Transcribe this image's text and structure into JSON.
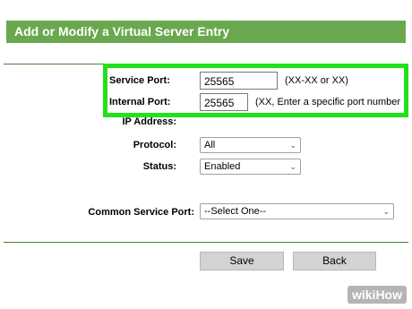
{
  "title": "Add or Modify a Virtual Server Entry",
  "fields": {
    "service_port": {
      "label": "Service Port:",
      "value": "25565",
      "hint": "(XX-XX or XX)"
    },
    "internal_port": {
      "label": "Internal Port:",
      "value": "25565",
      "hint": "(XX, Enter a specific port number"
    },
    "ip_address": {
      "label": "IP Address:"
    },
    "protocol": {
      "label": "Protocol:",
      "value": "All"
    },
    "status": {
      "label": "Status:",
      "value": "Enabled"
    },
    "common_service_port": {
      "label": "Common Service Port:",
      "value": "--Select One--"
    }
  },
  "buttons": {
    "save": "Save",
    "back": "Back"
  },
  "watermark": {
    "brand": "wikiHow"
  },
  "colors": {
    "title_bar": "#6aa84f",
    "highlight": "#22e01b"
  }
}
